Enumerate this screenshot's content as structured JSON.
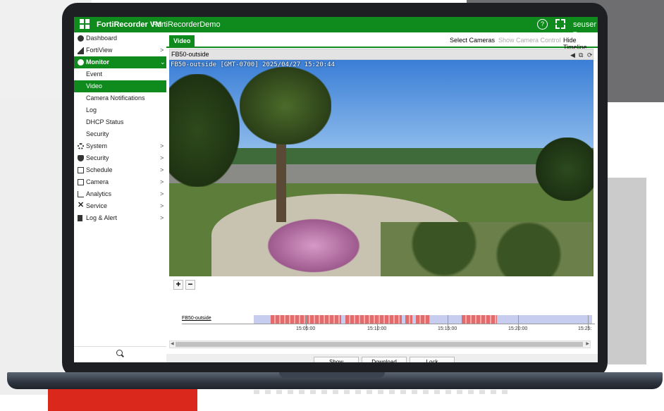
{
  "app": {
    "title": "FortiRecorder VM",
    "instance": "FortiRecorderDemo",
    "user": "seuser ▾",
    "help_glyph": "?"
  },
  "sidebar": {
    "items": [
      {
        "label": "Dashboard",
        "icon": "dashboard-icon"
      },
      {
        "label": "FortiView",
        "icon": "fortiview-icon",
        "chevron": ">"
      },
      {
        "label": "Monitor",
        "icon": "monitor-icon",
        "chevron": "⌄",
        "expanded": true
      },
      {
        "label": "System",
        "icon": "gear-icon",
        "chevron": ">"
      },
      {
        "label": "Security",
        "icon": "shield-icon",
        "chevron": ">"
      },
      {
        "label": "Schedule",
        "icon": "calendar-icon",
        "chevron": ">"
      },
      {
        "label": "Camera",
        "icon": "camera-icon",
        "chevron": ">"
      },
      {
        "label": "Analytics",
        "icon": "analytics-icon",
        "chevron": ">"
      },
      {
        "label": "Service",
        "icon": "service-icon",
        "chevron": ">"
      },
      {
        "label": "Log & Alert",
        "icon": "log-alert-icon",
        "chevron": ">"
      }
    ],
    "monitor_sub": [
      "Event",
      "Video",
      "Camera Notifications",
      "Log",
      "DHCP Status",
      "Security"
    ],
    "active_sub": "Video"
  },
  "main": {
    "tab": "Video",
    "actions": [
      "Select Cameras",
      "Show Camera Control",
      "Hide Timeline"
    ],
    "camera_title": "FB50-outside",
    "overlay": "FB50-outside [GMT-0700] 2025/04/27 15:20:44",
    "zoom_in": "+",
    "zoom_out": "−",
    "panel_icons": {
      "prev": "◀",
      "popout": "⧉",
      "refresh": "⟳"
    }
  },
  "timeline": {
    "track_label": "FB50-outside",
    "times": [
      "15:05:00",
      "15:10:00",
      "15:15:00",
      "15:20:00",
      "15:25:"
    ]
  },
  "footer": {
    "show": "Show",
    "download": "Download",
    "lock": "Lock"
  },
  "colors": {
    "brand": "#0f8a1d",
    "recorded": "#c7cdee",
    "event": "#e36b6b"
  }
}
